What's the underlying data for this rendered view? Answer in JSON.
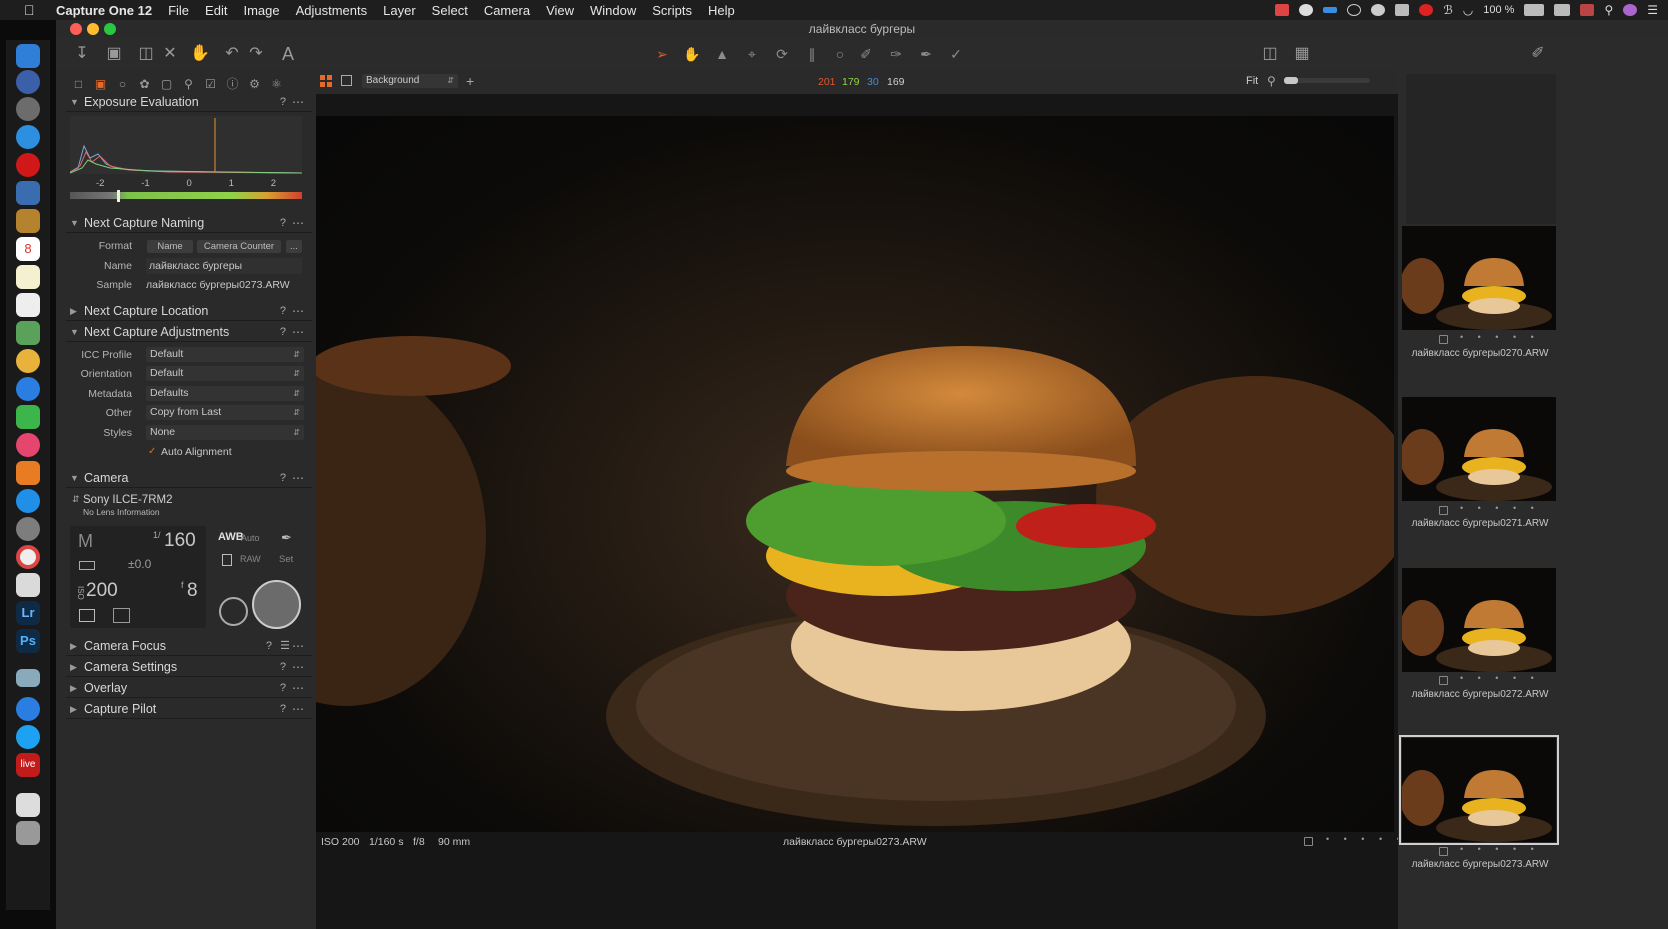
{
  "menubar": {
    "app_name": "Capture One 12",
    "items": [
      "File",
      "Edit",
      "Image",
      "Adjustments",
      "Layer",
      "Select",
      "Camera",
      "View",
      "Window",
      "Scripts",
      "Help"
    ],
    "battery": "100 %"
  },
  "window": {
    "title": "лайвкласс бургеры"
  },
  "toolbar": {
    "font_tool_label": "A"
  },
  "viewer_bar": {
    "variant": "Background",
    "rgb": {
      "r": "201",
      "g": "179",
      "b": "30",
      "l": "169"
    },
    "zoom": "Fit"
  },
  "exposure": {
    "title": "Exposure Evaluation",
    "scale": [
      "-2",
      "-1",
      "0",
      "1",
      "2"
    ]
  },
  "naming": {
    "title": "Next Capture Naming",
    "format_label": "Format",
    "format_tokens": [
      "Name",
      "Camera Counter",
      "..."
    ],
    "name_label": "Name",
    "name_value": "лайвкласс бургеры",
    "sample_label": "Sample",
    "sample_value": "лайвкласс бургеры0273.ARW"
  },
  "location": {
    "title": "Next Capture Location"
  },
  "adjustments": {
    "title": "Next Capture Adjustments",
    "rows": [
      {
        "label": "ICC Profile",
        "value": "Default"
      },
      {
        "label": "Orientation",
        "value": "Default"
      },
      {
        "label": "Metadata",
        "value": "Defaults"
      },
      {
        "label": "Other",
        "value": "Copy from Last"
      },
      {
        "label": "Styles",
        "value": "None"
      }
    ],
    "auto_alignment": "Auto Alignment"
  },
  "camera": {
    "title": "Camera",
    "model": "Sony ILCE-7RM2",
    "lens": "No Lens Information",
    "mode": "M",
    "shutter_num": "1/",
    "shutter": "160",
    "ev": "±0.0",
    "iso": "200",
    "aperture_prefix": "f",
    "aperture": "8",
    "wb": "AWB",
    "wb_auto": "Auto",
    "raw": "RAW",
    "set": "Set"
  },
  "collapsed_sections": [
    "Camera Focus",
    "Camera Settings",
    "Overlay",
    "Capture Pilot"
  ],
  "status": {
    "iso": "ISO 200",
    "shutter": "1/160 s",
    "aperture": "f/8",
    "focal": "90 mm",
    "filename": "лайвкласс бургеры0273.ARW"
  },
  "filmstrip": [
    {
      "name": "лайвкласс бургеры0270.ARW",
      "selected": false
    },
    {
      "name": "лайвкласс бургеры0271.ARW",
      "selected": false
    },
    {
      "name": "лайвкласс бургеры0272.ARW",
      "selected": false
    },
    {
      "name": "лайвкласс бургеры0273.ARW",
      "selected": true
    }
  ],
  "dock_badge": "8",
  "dock_apps": [
    "Lr",
    "Ps",
    "live"
  ],
  "colors": {
    "accent": "#e36a2b",
    "r": "#e0582b",
    "g": "#8fd24a",
    "b": "#4a8ad8"
  }
}
